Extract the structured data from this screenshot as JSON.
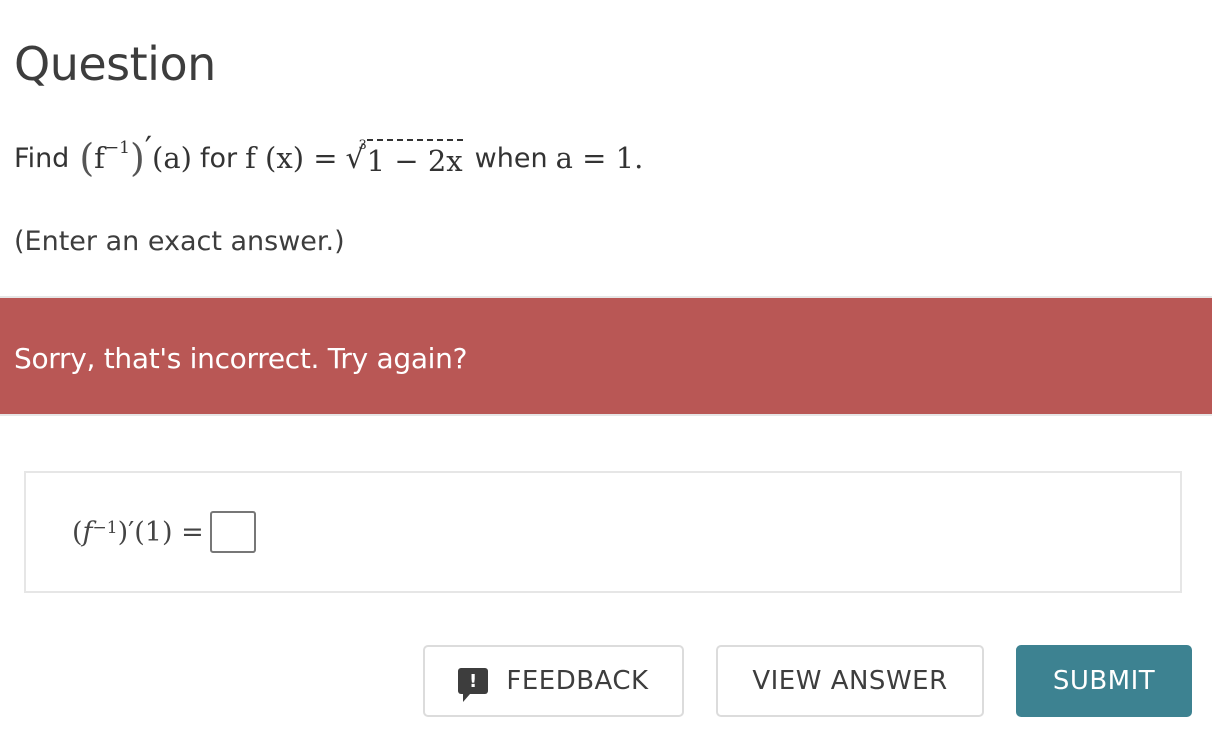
{
  "question": {
    "heading": "Question",
    "prompt": {
      "find_word": "Find",
      "f_inverse_base": "f",
      "inverse_exponent": "−1",
      "prime": "′",
      "arg_a": "(a)",
      "for_word": "for",
      "function_lhs": "f (x) =",
      "root_index": "3",
      "radicand": "1 − 2x",
      "when_word": "when",
      "condition": "a = 1."
    },
    "note": "(Enter an exact answer.)"
  },
  "feedback_banner": {
    "message": "Sorry, that's incorrect. Try again?",
    "color": "#b95755"
  },
  "answer": {
    "lhs_open": "(",
    "lhs_f": "f",
    "lhs_exponent": "−1",
    "lhs_close": ")′(1) =",
    "input_value": ""
  },
  "buttons": {
    "feedback_label": "FEEDBACK",
    "feedback_icon_glyph": "!",
    "view_answer_label": "VIEW ANSWER",
    "submit_label": "SUBMIT",
    "submit_color": "#3d8291"
  }
}
